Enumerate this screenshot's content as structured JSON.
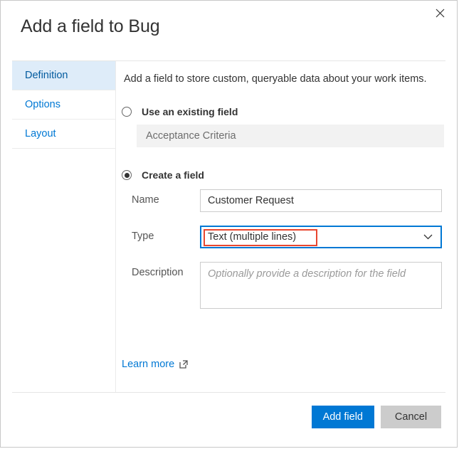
{
  "dialog": {
    "title": "Add a field to Bug",
    "close_icon": "close-icon"
  },
  "sidebar": {
    "items": [
      {
        "label": "Definition",
        "selected": true
      },
      {
        "label": "Options",
        "selected": false
      },
      {
        "label": "Layout",
        "selected": false
      }
    ]
  },
  "content": {
    "intro": "Add a field to store custom, queryable data about your work items.",
    "existing": {
      "radio_label": "Use an existing field",
      "checked": false,
      "field_value": "Acceptance Criteria"
    },
    "create": {
      "radio_label": "Create a field",
      "checked": true,
      "name_label": "Name",
      "name_value": "Customer Request",
      "name_placeholder": "",
      "type_label": "Type",
      "type_value": "Text (multiple lines)",
      "type_chevron_icon": "chevron-down-icon",
      "description_label": "Description",
      "description_value": "",
      "description_placeholder": "Optionally provide a description for the field"
    },
    "learn_more": {
      "label": "Learn more",
      "icon": "external-link-icon"
    }
  },
  "footer": {
    "primary_label": "Add field",
    "secondary_label": "Cancel"
  },
  "colors": {
    "accent": "#0078d4",
    "tab_selected_bg": "#deecf9",
    "annotation": "#e8462f",
    "secondary_button": "#cccccc",
    "disabled_field": "#f2f2f2"
  }
}
